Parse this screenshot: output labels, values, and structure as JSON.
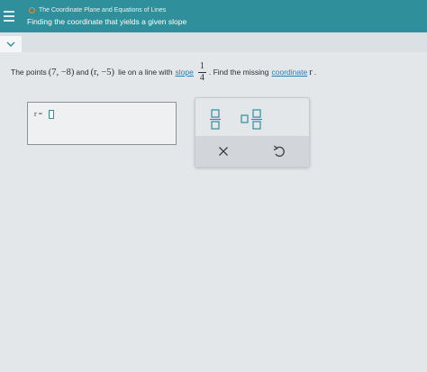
{
  "header": {
    "topic": "The Coordinate Plane and Equations of Lines",
    "title": "Finding the coordinate that yields a given slope"
  },
  "problem": {
    "intro": "The points",
    "point1": "(7, −8)",
    "and_text": "and",
    "point2": "(r, −5)",
    "line_text": "lie on a line with",
    "slope_link": "slope",
    "slope_numerator": "1",
    "slope_denominator": "4",
    "find_text": ". Find the missing",
    "coordinate_link": "coordinate",
    "variable": "r",
    "end": "."
  },
  "answer": {
    "label": "r =",
    "value": ""
  },
  "colors": {
    "header": "#2f8f9a",
    "link": "#2a7db0",
    "topic_dot": "#f08b2a"
  },
  "icons": [
    "menu-icon",
    "chevron-down-icon",
    "fraction-icon",
    "mixed-number-icon",
    "close-icon",
    "undo-icon"
  ]
}
